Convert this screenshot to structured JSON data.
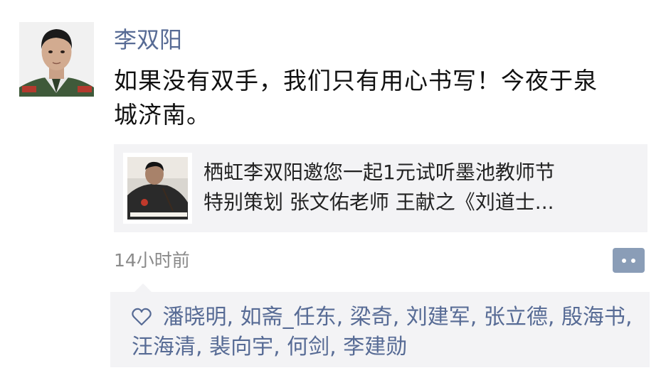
{
  "post": {
    "author": "李双阳",
    "text_line1": "如果没有双手，我们只有用心书写！今夜于泉",
    "text_line2": "城济南。",
    "time": "14小时前"
  },
  "share": {
    "title_line1": "栖虹李双阳邀您一起1元试听墨池教师节",
    "title_line2": "特别策划 张文佑老师 王献之《刘道士..."
  },
  "likes": {
    "names": [
      "潘晓明",
      "如斋_任东",
      "梁奇",
      "刘建军",
      "张立德",
      "殷海书",
      "汪海清",
      "裴向宇",
      "何剑",
      "李建勋"
    ],
    "separator": ", "
  },
  "icons": {
    "like": "heart-outline-icon",
    "comment": "comment-dots-icon"
  },
  "colors": {
    "link_blue": "#576b95",
    "card_bg": "#f3f3f5",
    "time_gray": "#8a8a8a",
    "comment_button": "#8a9db7"
  }
}
